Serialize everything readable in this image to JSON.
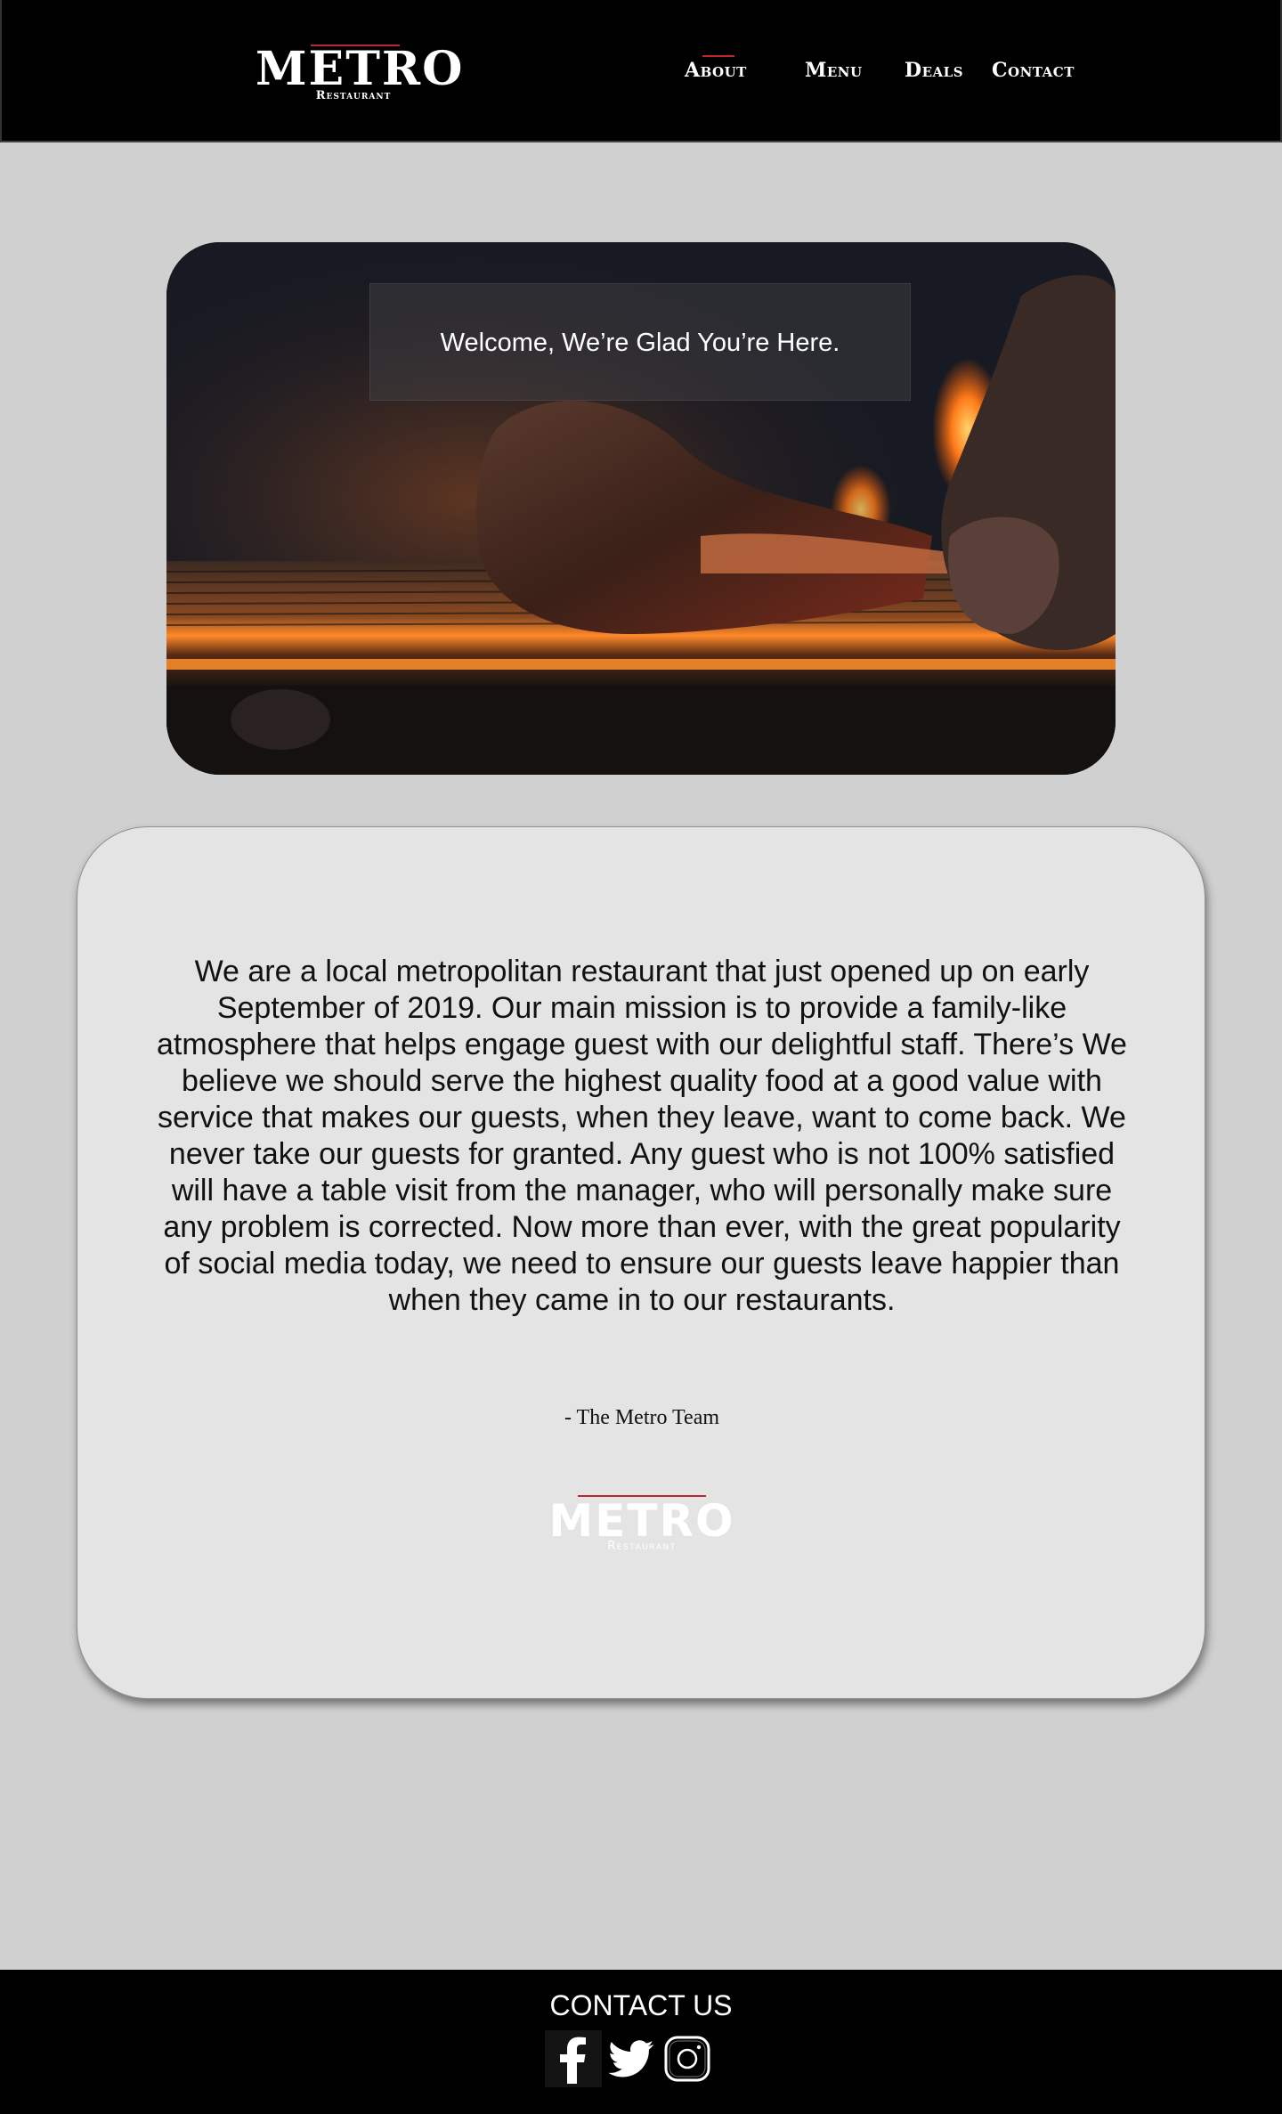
{
  "header": {
    "logo": {
      "word": "METRO",
      "subtitle": "Restaurant"
    },
    "nav": [
      {
        "label": "About"
      },
      {
        "label": "Menu"
      },
      {
        "label": "Deals"
      },
      {
        "label": "Contact"
      }
    ],
    "active_nav": "About"
  },
  "hero": {
    "caption": "Welcome, We’re Glad You’re Here."
  },
  "about": {
    "paragraph": "We are a local metropolitan restaurant that just opened up on early September of 2019.  Our main mission is to provide a family-like atmosphere that helps engage guest with our delightful staff. There’s We believe we should serve the highest quality food at a good value with service that makes our guests, when they leave, want to come back. We never take our guests for granted. Any guest who is not 100% satisfied will have a table visit from the manager, who will personally make sure any problem is corrected. Now more than ever, with the great popularity of social media today, we need to ensure our guests leave happier than when they came in to our restaurants.",
    "signature": "- The Metro Team",
    "logo": {
      "word": "METRO",
      "subtitle": "Restaurant"
    }
  },
  "footer": {
    "title": "CONTACT US",
    "social": [
      {
        "icon": "facebook-icon"
      },
      {
        "icon": "twitter-icon"
      },
      {
        "icon": "instagram-icon"
      }
    ]
  },
  "colors": {
    "header_bg": "#000000",
    "page_bg": "#d0d0d0",
    "card_bg": "#e4e4e4",
    "accent": "#c0262d",
    "footer_bg": "#000000"
  }
}
